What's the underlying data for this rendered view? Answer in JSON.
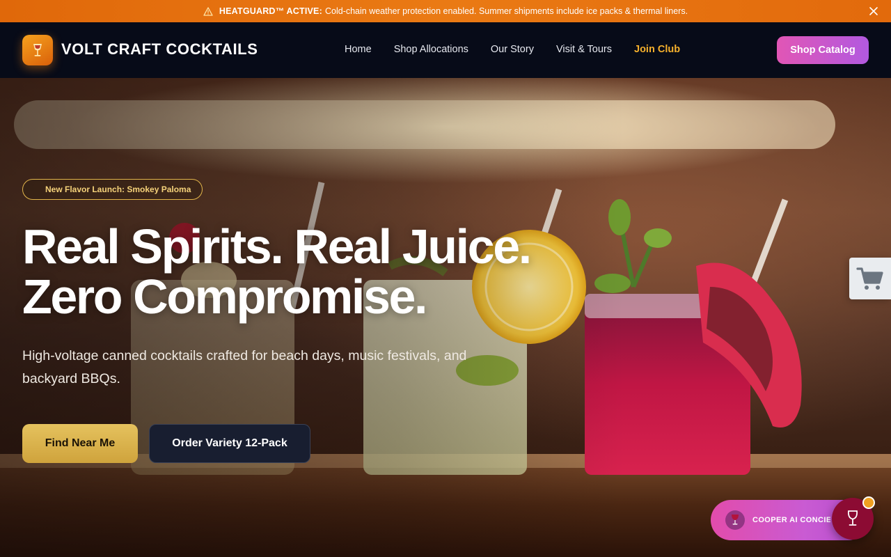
{
  "announcement": {
    "label": "HEATGUARD™ ACTIVE:",
    "text": "Cold-chain weather protection enabled. Summer shipments include ice packs & thermal liners.",
    "icon": "warning-icon",
    "close_icon": "close-icon"
  },
  "header": {
    "brand": "VOLT CRAFT COCKTAILS",
    "logo_icon": "cocktail-glass-icon",
    "nav": [
      {
        "label": "Home"
      },
      {
        "label": "Shop Allocations"
      },
      {
        "label": "Our Story"
      },
      {
        "label": "Visit & Tours"
      },
      {
        "label": "Join Club"
      }
    ],
    "cta": "Shop Catalog"
  },
  "hero": {
    "badge": "New Flavor Launch: Smokey Paloma",
    "headline_line1": "Real Spirits. Real Juice.",
    "headline_line2": "Zero Compromise.",
    "subtext": "High-voltage canned cocktails crafted for beach days, music festivals, and backyard BBQs.",
    "primary_button": "Find Near Me",
    "secondary_button": "Order Variety 12-Pack"
  },
  "widgets": {
    "cart_icon": "shopping-cart-icon",
    "concierge_label": "COOPER AI CONCIERGE",
    "concierge_icon": "wine-glass-icon",
    "fab_icon": "wine-glass-icon"
  },
  "colors": {
    "announcement": "#e8720f",
    "header_bg": "#070b18",
    "accent_gold": "#f5b02c",
    "cta_gradient_start": "#e156b5",
    "cta_gradient_end": "#b259e0",
    "fab": "#8c0b33"
  }
}
